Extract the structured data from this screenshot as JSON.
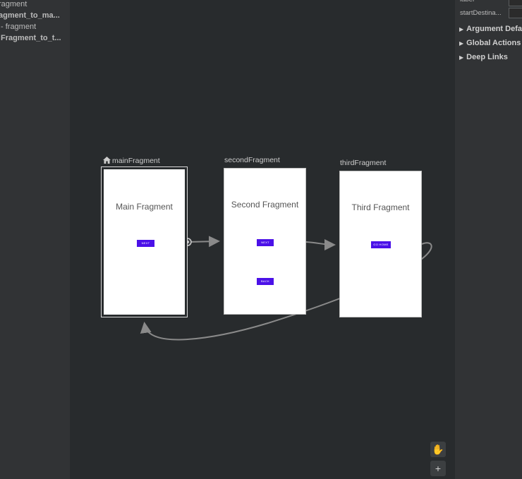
{
  "component_tree": {
    "items": [
      {
        "label": "ragment",
        "bold": false
      },
      {
        "label": "agment_to_ma...",
        "bold": true
      },
      {
        "label": "- fragment",
        "bold": false
      },
      {
        "label": "Fragment_to_t...",
        "bold": true
      }
    ]
  },
  "attributes": {
    "label_row": "label",
    "start_destination_row": "startDestina...",
    "sections": [
      "Argument Defa",
      "Global Actions",
      "Deep Links"
    ]
  },
  "graph": {
    "destinations": [
      {
        "id": "mainFragment",
        "label": "mainFragment",
        "is_start": true,
        "screen_title": "Main Fragment",
        "buttons": [
          "NEXT"
        ],
        "selected": true
      },
      {
        "id": "secondFragment",
        "label": "secondFragment",
        "is_start": false,
        "screen_title": "Second Fragment",
        "buttons": [
          "NEXT",
          "BACK"
        ],
        "selected": false
      },
      {
        "id": "thirdFragment",
        "label": "thirdFragment",
        "is_start": false,
        "screen_title": "Third Fragment",
        "buttons": [
          "GO HOME"
        ],
        "selected": false
      }
    ],
    "actions": [
      {
        "from": "mainFragment",
        "to": "secondFragment"
      },
      {
        "from": "secondFragment",
        "to": "thirdFragment"
      },
      {
        "from": "thirdFragment",
        "to": "mainFragment"
      }
    ]
  },
  "toolbar": {
    "pan_icon": "hand-icon",
    "zoom_in_label": "+"
  },
  "colors": {
    "canvas_bg": "#282b2d",
    "panel_bg": "#313335",
    "button_accent": "#4b11e8",
    "arrow": "#8a8a8a"
  }
}
